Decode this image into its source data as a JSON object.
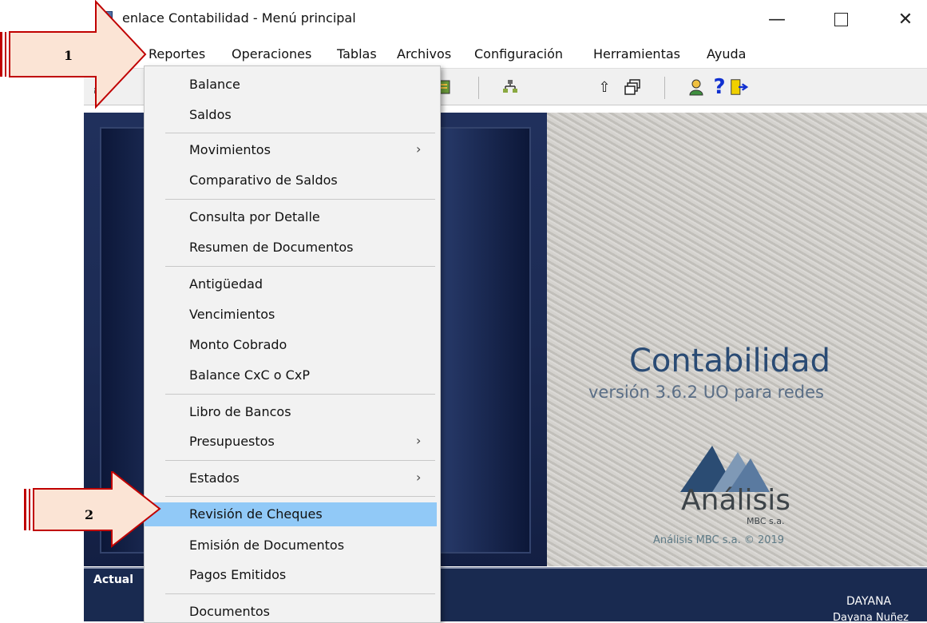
{
  "window": {
    "title": "enlace Contabilidad - Menú principal",
    "controls": {
      "minimize": "—",
      "maximize": "",
      "close": "✕"
    }
  },
  "menubar": {
    "items": [
      "Reportes",
      "Operaciones",
      "Tablas",
      "Archivos",
      "Configuración",
      "Herramientas",
      "Ayuda"
    ]
  },
  "dropdown": {
    "items": [
      {
        "label": "Balance",
        "submenu": false
      },
      {
        "label": "Saldos",
        "submenu": false
      },
      {
        "label": "Movimientos",
        "submenu": true
      },
      {
        "label": "Comparativo de Saldos",
        "submenu": false
      },
      {
        "label": "Consulta por Detalle",
        "submenu": false
      },
      {
        "label": "Resumen de Documentos",
        "submenu": false
      },
      {
        "label": "Antigüedad",
        "submenu": false
      },
      {
        "label": "Vencimientos",
        "submenu": false
      },
      {
        "label": "Monto Cobrado",
        "submenu": false
      },
      {
        "label": "Balance CxC o CxP",
        "submenu": false
      },
      {
        "label": "Libro de Bancos",
        "submenu": false
      },
      {
        "label": "Presupuestos",
        "submenu": true
      },
      {
        "label": "Estados",
        "submenu": true
      },
      {
        "label": "Revisión de Cheques",
        "submenu": false,
        "highlighted": true
      },
      {
        "label": "Emisión de Documentos",
        "submenu": false
      },
      {
        "label": "Pagos Emitidos",
        "submenu": false
      },
      {
        "label": "Documentos",
        "submenu": false
      }
    ],
    "submenu_arrow": "›"
  },
  "splash": {
    "product_name": "Contabilidad",
    "version": "versión 3.6.2 UO para redes",
    "logo_name": "Análisis",
    "logo_sub": "MBC s.a.",
    "copyright": "Análisis MBC s.a. © 2019"
  },
  "statusbar": {
    "left_text": "Actual",
    "user": "DAYANA",
    "user_name": "Dayana Nuñez"
  },
  "callouts": {
    "one": "1",
    "two": "2"
  },
  "colors": {
    "menu_highlight": "#91c9f7",
    "arrow_fill": "#fbe4d5",
    "arrow_border": "#c00000",
    "splash_title": "#2a4b74"
  }
}
